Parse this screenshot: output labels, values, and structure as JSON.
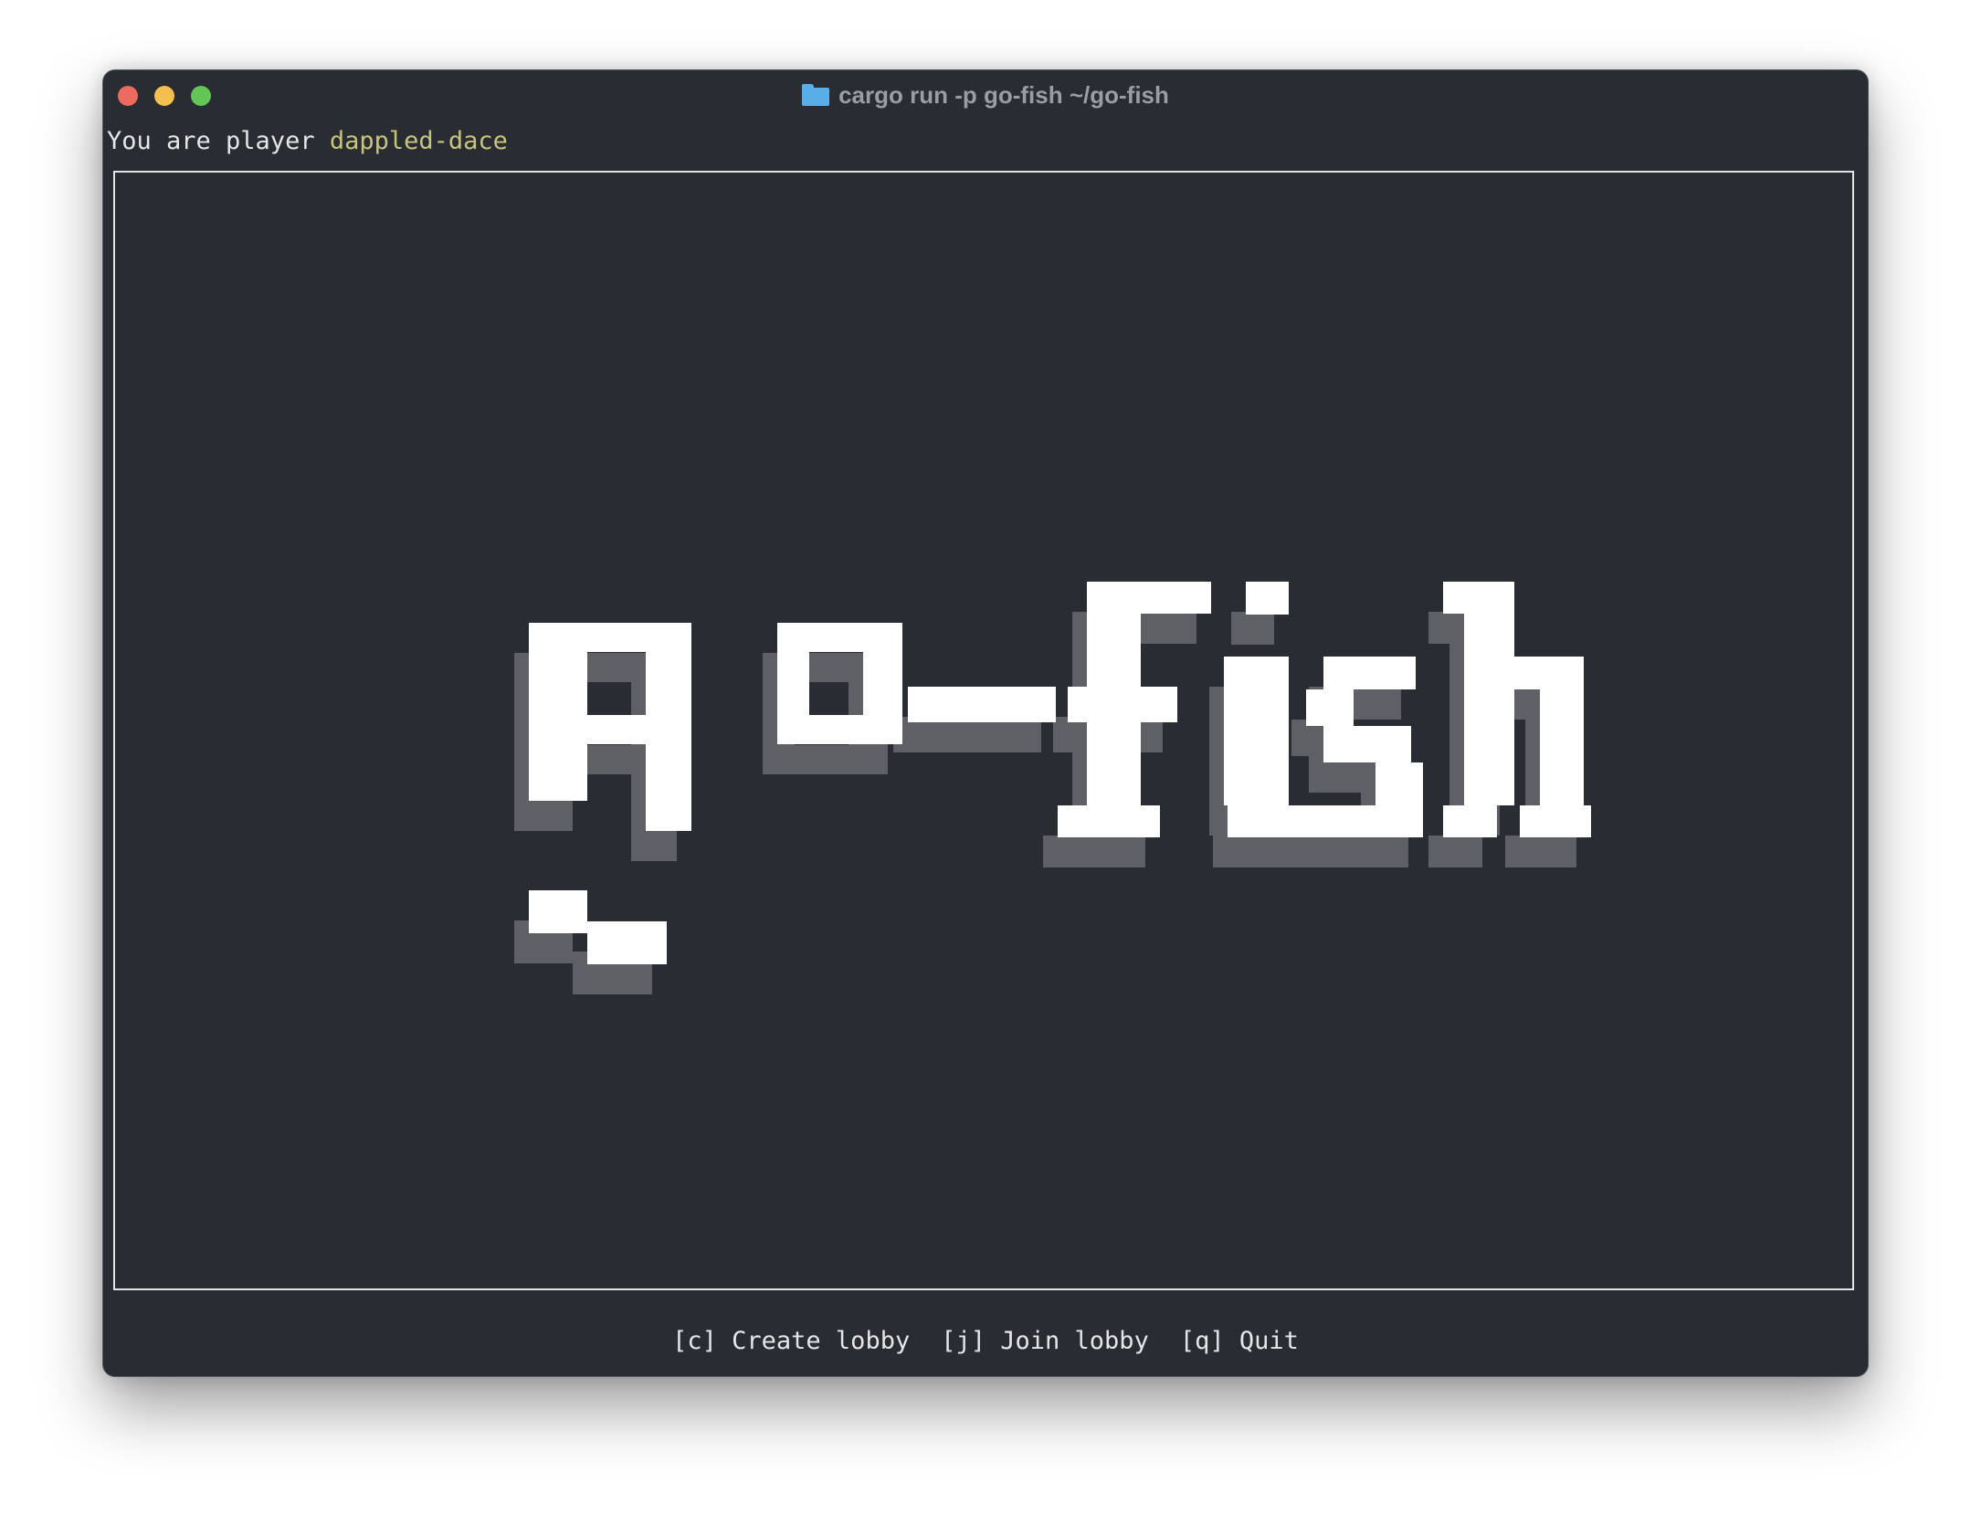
{
  "window": {
    "title": "cargo run -p go-fish ~/go-fish",
    "title_icon": "folder-icon",
    "traffic_lights": {
      "close_color": "#ed6a5e",
      "minimize_color": "#f5bf4f",
      "maximize_color": "#62c554"
    }
  },
  "colors": {
    "background": "#292c33",
    "text": "#e6e6e6",
    "player_name": "#c8c47c",
    "logo_fill": "#ffffff",
    "logo_shadow": "#5f6066",
    "folder": "#5aaee8"
  },
  "status": {
    "prefix": "You are player ",
    "player_name": "dappled-dace"
  },
  "logo": {
    "text": "go-fish"
  },
  "menu": {
    "items": [
      {
        "key": "[c]",
        "label": "Create lobby"
      },
      {
        "key": "[j]",
        "label": "Join lobby"
      },
      {
        "key": "[q]",
        "label": "Quit"
      }
    ]
  }
}
